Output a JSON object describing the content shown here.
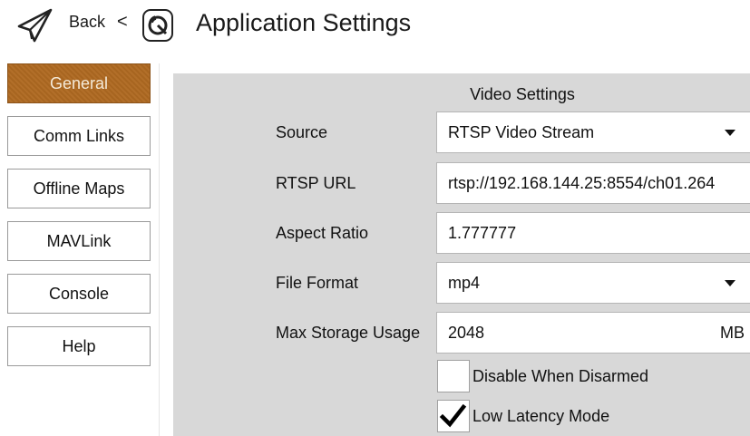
{
  "header": {
    "back_label": "Back",
    "separator": "<",
    "title": "Application Settings"
  },
  "sidebar": {
    "items": [
      {
        "label": "General",
        "active": true
      },
      {
        "label": "Comm Links",
        "active": false
      },
      {
        "label": "Offline Maps",
        "active": false
      },
      {
        "label": "MAVLink",
        "active": false
      },
      {
        "label": "Console",
        "active": false
      },
      {
        "label": "Help",
        "active": false
      }
    ]
  },
  "video_settings": {
    "title": "Video Settings",
    "source": {
      "label": "Source",
      "value": "RTSP Video Stream"
    },
    "rtsp_url": {
      "label": "RTSP URL",
      "value": "rtsp://192.168.144.25:8554/ch01.264"
    },
    "aspect_ratio": {
      "label": "Aspect Ratio",
      "value": "1.777777"
    },
    "file_format": {
      "label": "File Format",
      "value": "mp4"
    },
    "max_storage": {
      "label": "Max Storage Usage",
      "value": "2048",
      "unit": "MB"
    },
    "disable_when_disarmed": {
      "label": "Disable When Disarmed",
      "checked": false
    },
    "low_latency": {
      "label": "Low Latency Mode",
      "checked": true
    }
  },
  "colors": {
    "accent": "#b06a22",
    "panel_bg": "#d8d8d8",
    "field_bg": "#ffffff"
  },
  "icons": {
    "back": "paper-plane-icon",
    "logo": "qgroundcontrol-logo-icon",
    "dropdown": "chevron-down-icon",
    "check": "checkmark-icon"
  }
}
